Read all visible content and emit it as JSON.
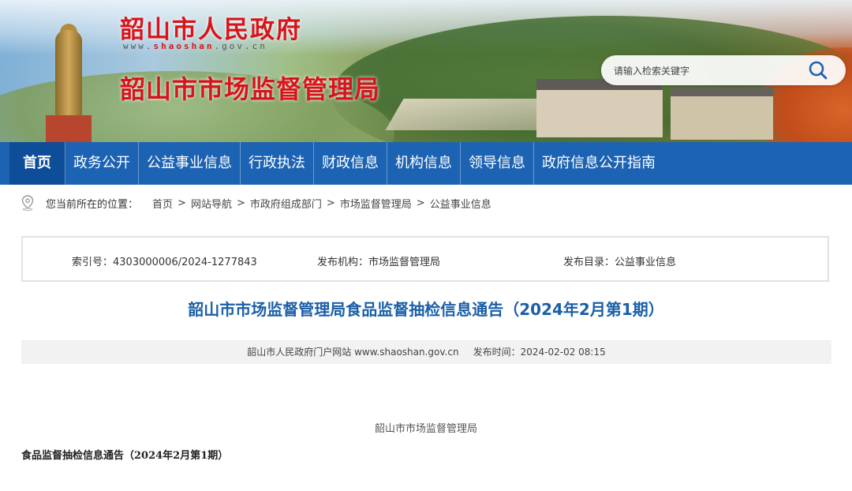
{
  "header": {
    "site_title": "韶山市人民政府",
    "site_url_prefix": "www.",
    "site_url_highlight": "shaoshan",
    "site_url_suffix": ".gov.cn",
    "dept_title": "韶山市市场监督管理局",
    "search_placeholder": "请输入检索关键字",
    "brand_color": "#d8141b"
  },
  "nav": {
    "items": [
      {
        "label": "首页",
        "active": true
      },
      {
        "label": "政务公开"
      },
      {
        "label": "公益事业信息"
      },
      {
        "label": "行政执法"
      },
      {
        "label": "财政信息"
      },
      {
        "label": "机构信息"
      },
      {
        "label": "领导信息"
      },
      {
        "label": "政府信息公开指南"
      }
    ],
    "bg_color": "#1d63b4"
  },
  "breadcrumb": {
    "label": "您当前所在的位置：",
    "items": [
      "首页",
      "网站导航",
      "市政府组成部门",
      "市场监督管理局",
      "公益事业信息"
    ],
    "separator": ">"
  },
  "meta": {
    "index_label": "索引号：",
    "index_value": "4303000006/2024-1277843",
    "publisher_label": "发布机构：",
    "publisher_value": "市场监督管理局",
    "catalog_label": "发布目录：",
    "catalog_value": "公益事业信息"
  },
  "article": {
    "title": "韶山市市场监督管理局食品监督抽检信息通告（2024年2月第1期）",
    "source": "韶山市人民政府门户网站 www.shaoshan.gov.cn",
    "date_label": "发布时间：",
    "date_value": "2024-02-02 08:15",
    "body_org": "韶山市市场监督管理局",
    "body_subtitle": "食品监督抽检信息通告（2024年2月第1期）",
    "title_color": "#1a5fa8"
  }
}
